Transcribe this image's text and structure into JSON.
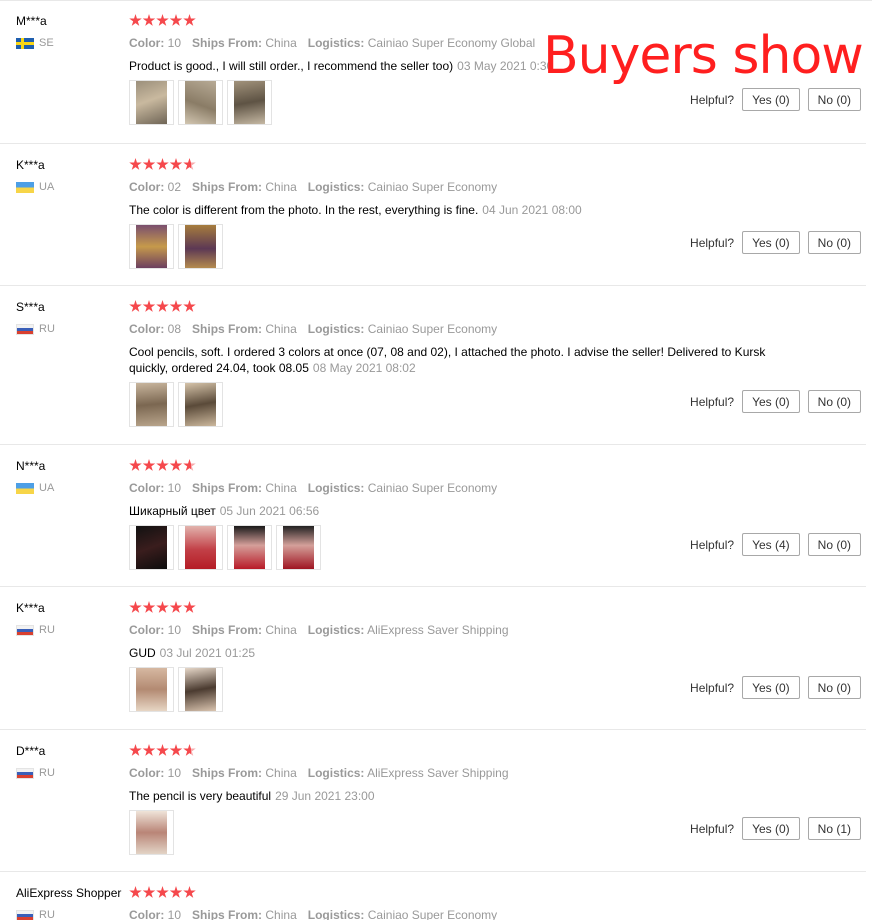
{
  "overlay_text": "Buyers show",
  "labels": {
    "color": "Color:",
    "ships_from": "Ships From:",
    "logistics": "Logistics:",
    "helpful": "Helpful?"
  },
  "reviews": [
    {
      "user": "M***a",
      "country": "SE",
      "flag": "se",
      "stars": 5,
      "color": "10",
      "ships_from": "China",
      "logistics": "Cainiao Super Economy Global",
      "text": "Product is good., I will still order., I recommend the seller too)",
      "date": "03 May 2021 0:30",
      "photos": 3,
      "yes": "Yes (0)",
      "no": "No (0)"
    },
    {
      "user": "K***a",
      "country": "UA",
      "flag": "ua",
      "stars": 4.5,
      "color": "02",
      "ships_from": "China",
      "logistics": "Cainiao Super Economy",
      "text": "The color is different from the photo. In the rest, everything is fine.",
      "date": "04 Jun 2021 08:00",
      "photos": 2,
      "yes": "Yes (0)",
      "no": "No (0)"
    },
    {
      "user": "S***a",
      "country": "RU",
      "flag": "ru",
      "stars": 5,
      "color": "08",
      "ships_from": "China",
      "logistics": "Cainiao Super Economy",
      "text": "Cool pencils, soft. I ordered 3 colors at once (07, 08 and 02), I attached the photo. I advise the seller! Delivered to Kursk quickly, ordered 24.04, took 08.05",
      "date": "08 May 2021 08:02",
      "photos": 2,
      "yes": "Yes (0)",
      "no": "No (0)"
    },
    {
      "user": "N***a",
      "country": "UA",
      "flag": "ua",
      "stars": 4.5,
      "color": "10",
      "ships_from": "China",
      "logistics": "Cainiao Super Economy",
      "text": "Шикарный цвет",
      "date": "05 Jun 2021 06:56",
      "photos": 4,
      "yes": "Yes (4)",
      "no": "No (0)"
    },
    {
      "user": "K***a",
      "country": "RU",
      "flag": "ru",
      "stars": 5,
      "color": "10",
      "ships_from": "China",
      "logistics": "AliExpress Saver Shipping",
      "text": "GUD",
      "date": "03 Jul 2021 01:25",
      "photos": 2,
      "yes": "Yes (0)",
      "no": "No (0)"
    },
    {
      "user": "D***a",
      "country": "RU",
      "flag": "ru",
      "stars": 4.5,
      "color": "10",
      "ships_from": "China",
      "logistics": "AliExpress Saver Shipping",
      "text": "The pencil is very beautiful",
      "date": "29 Jun 2021 23:00",
      "photos": 1,
      "yes": "Yes (0)",
      "no": "No (1)"
    },
    {
      "user": "AliExpress Shopper",
      "country": "RU",
      "flag": "ru",
      "stars": 5,
      "color": "10",
      "ships_from": "China",
      "logistics": "Cainiao Super Economy",
      "text": "",
      "date": "",
      "photos": 0,
      "yes": "",
      "no": ""
    }
  ]
}
